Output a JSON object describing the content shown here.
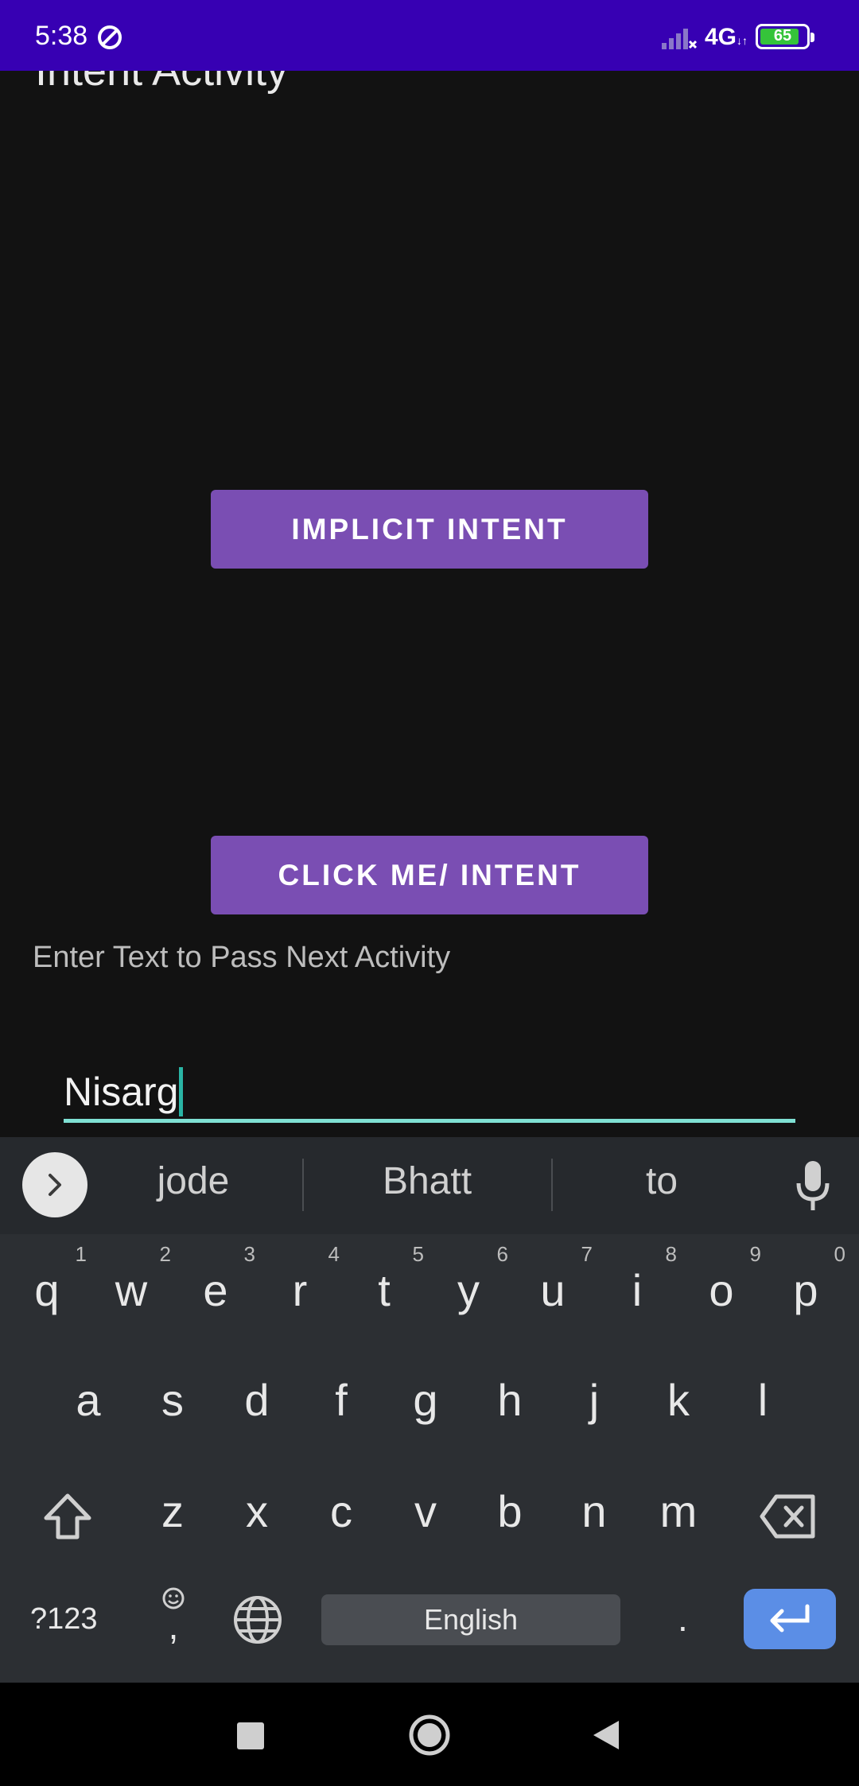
{
  "status_bar": {
    "time": "5:38",
    "network": "4G",
    "battery": "65",
    "battery_level": 0.65
  },
  "app": {
    "title": "Intent Activity",
    "implicit_button": "IMPLICIT INTENT",
    "click_button": "CLICK ME/ INTENT",
    "hint_label": "Enter Text to Pass Next Activity",
    "text_value": "Nisarg",
    "accent_color": "#7a4eb3",
    "field_underline_color": "#7fe0d3"
  },
  "keyboard": {
    "suggestions": [
      "jode",
      "Bhatt",
      "to"
    ],
    "row1": [
      {
        "k": "q",
        "n": "1"
      },
      {
        "k": "w",
        "n": "2"
      },
      {
        "k": "e",
        "n": "3"
      },
      {
        "k": "r",
        "n": "4"
      },
      {
        "k": "t",
        "n": "5"
      },
      {
        "k": "y",
        "n": "6"
      },
      {
        "k": "u",
        "n": "7"
      },
      {
        "k": "i",
        "n": "8"
      },
      {
        "k": "o",
        "n": "9"
      },
      {
        "k": "p",
        "n": "0"
      }
    ],
    "row2": [
      "a",
      "s",
      "d",
      "f",
      "g",
      "h",
      "j",
      "k",
      "l"
    ],
    "row3": [
      "z",
      "x",
      "c",
      "v",
      "b",
      "n",
      "m"
    ],
    "symbols_label": "?123",
    "emoji_comma": ",",
    "space_label": "English",
    "period_label": ".",
    "enter_color": "#5b8ee6"
  },
  "icons": {
    "status": [
      "dnd-icon",
      "signal-icon",
      "battery-icon"
    ],
    "keyboard": [
      "expand-suggestions-icon",
      "mic-icon",
      "shift-icon",
      "backspace-icon",
      "emoji-icon",
      "globe-icon",
      "enter-icon"
    ],
    "navbar": [
      "recents-icon",
      "home-icon",
      "back-icon"
    ]
  }
}
